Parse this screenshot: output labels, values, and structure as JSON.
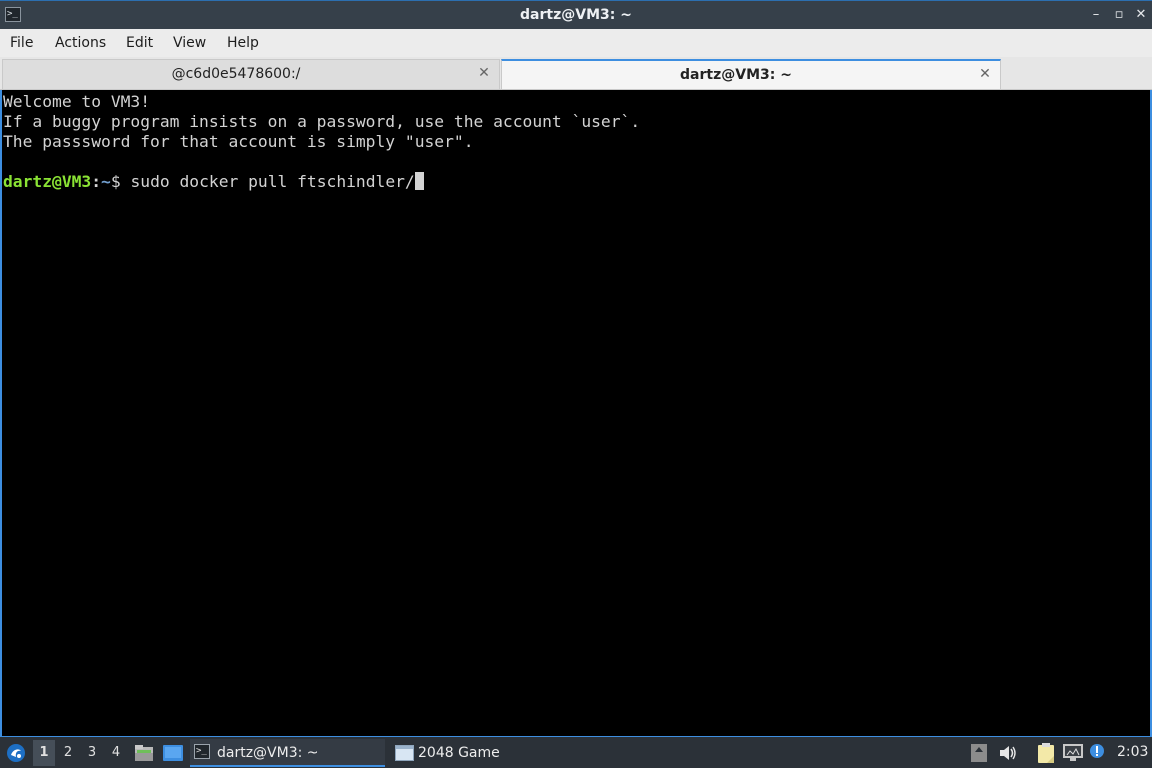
{
  "window": {
    "title": "dartz@VM3: ~",
    "app_icon_glyph": ">_",
    "controls": {
      "minimize": "–",
      "restore": "▫",
      "close": "✕"
    }
  },
  "menu": {
    "items": [
      "File",
      "Actions",
      "Edit",
      "View",
      "Help"
    ]
  },
  "tabs": [
    {
      "label": "@c6d0e5478600:/",
      "close": "✕",
      "active": false
    },
    {
      "label": "dartz@VM3: ~",
      "close": "✕",
      "active": true
    }
  ],
  "terminal": {
    "lines": [
      "Welcome to VM3!",
      "If a buggy program insists on a password, use the account `user`.",
      "The passsword for that account is simply \"user\"."
    ],
    "prompt": {
      "user_host": "dartz@VM3",
      "separator": ":",
      "path": "~",
      "symbol": "$ ",
      "command": "sudo docker pull ftschindler/"
    }
  },
  "taskbar": {
    "workspaces": [
      "1",
      "2",
      "3",
      "4"
    ],
    "tasks": [
      {
        "label": "dartz@VM3: ~",
        "icon": "terminal-icon",
        "active": true
      },
      {
        "label": "2048 Game",
        "icon": "window-icon",
        "active": false
      }
    ],
    "clock": "2:03",
    "tray_icons": [
      "scroll-icon",
      "volume-icon",
      "clipboard-icon",
      "network-icon",
      "notification-icon"
    ]
  },
  "colors": {
    "accent": "#3d8ee0",
    "prompt_user": "#8ae234",
    "prompt_path": "#729fcf",
    "terminal_bg": "#000000",
    "terminal_fg": "#d3d3d3"
  }
}
